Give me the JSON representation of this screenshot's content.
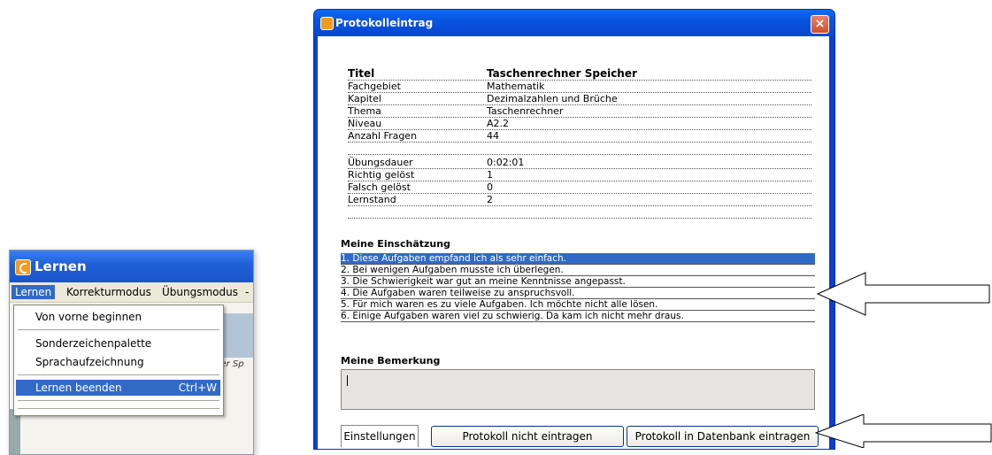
{
  "lernen_window": {
    "title": "Lernen",
    "menubar": [
      "Lernen",
      "Korrekturmodus",
      "Übungsmodus",
      "-"
    ],
    "dropdown": {
      "items": [
        {
          "label": "Von vorne beginnen",
          "shortcut": ""
        },
        {
          "label": "Sonderzeichenpalette",
          "shortcut": ""
        },
        {
          "label": "Sprachaufzeichnung",
          "shortcut": ""
        },
        {
          "label": "Lernen beenden",
          "shortcut": "Ctrl+W",
          "selected": true
        }
      ]
    },
    "background_hint": "oder Sp"
  },
  "dialog": {
    "title": "Protokolleintrag",
    "close": "×",
    "info_rows": [
      {
        "key": "Titel",
        "value": "Taschenrechner Speicher"
      },
      {
        "key": "Fachgebiet",
        "value": "Mathematik"
      },
      {
        "key": "Kapitel",
        "value": "Dezimalzahlen und Brüche"
      },
      {
        "key": "Thema",
        "value": "Taschenrechner"
      },
      {
        "key": "Niveau",
        "value": "A2.2"
      },
      {
        "key": "Anzahl Fragen",
        "value": "44"
      }
    ],
    "stats_rows": [
      {
        "key": "Übungsdauer",
        "value": "0:02:01"
      },
      {
        "key": "Richtig gelöst",
        "value": "1"
      },
      {
        "key": "Falsch gelöst",
        "value": "0"
      },
      {
        "key": "Lernstand",
        "value": "2"
      }
    ],
    "assessment_heading": "Meine Einschätzung",
    "assessment_options": [
      "1. Diese Aufgaben empfand ich als sehr einfach.",
      "2. Bei wenigen Aufgaben musste ich überlegen.",
      "3. Die Schwierigkeit war gut an meine Kenntnisse angepasst.",
      "4. Die Aufgaben waren teilweise zu anspruchsvoll.",
      "5. Für mich waren es zu viele Aufgaben. Ich möchte nicht alle lösen.",
      "6. Einige Aufgaben waren viel zu schwierig. Da kam ich nicht mehr draus."
    ],
    "selected_option_index": 0,
    "remark_heading": "Meine Bemerkung",
    "remark_value": "",
    "tab_label": "Einstellungen",
    "button_no": "Protokoll nicht eintragen",
    "button_yes": "Protokoll in Datenbank eintragen"
  },
  "colors": {
    "xp_title_blue": "#0a54e3",
    "selection_blue": "#316ac5",
    "close_red": "#d14d2b",
    "logo_orange": "#f29a1a"
  }
}
